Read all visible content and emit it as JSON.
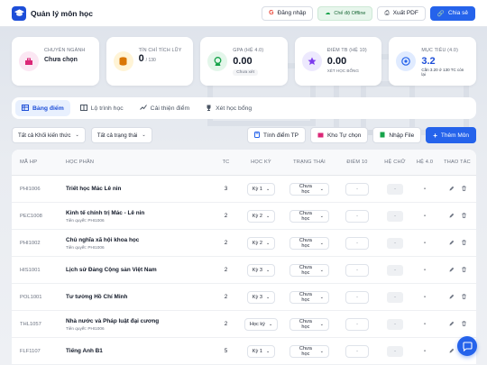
{
  "header": {
    "title": "Quản lý môn học",
    "login_label": "Đăng nhập",
    "offline_label": "Chế độ Offline",
    "export_label": "Xuất PDF",
    "share_label": "Chia sẻ"
  },
  "cards": [
    {
      "label": "Chuyên ngành",
      "value": "Chưa chọn",
      "color": "#fbe7f3"
    },
    {
      "label": "Tín chỉ tích lũy",
      "value": "0",
      "sub": "/ 130",
      "color": "#fff4d6"
    },
    {
      "label": "GPA (hệ 4.0)",
      "value": "0.00",
      "badge": "Chưa xét",
      "color": "#e3f6ea"
    },
    {
      "label": "Điểm TB (hệ 10)",
      "value": "0.00",
      "sub": "Xét học bổng",
      "color": "#ede9fe"
    },
    {
      "label": "Mục tiêu (4.0)",
      "value": "3.2",
      "sub": "Cần 3.20 ở 130 TC còn lại",
      "color": "#e0ebff"
    }
  ],
  "tabs": [
    "Bảng điểm",
    "Lộ trình học",
    "Cải thiện điểm",
    "Xét học bổng"
  ],
  "filters": {
    "knowledge": "Tất cả Khối kiến thức",
    "status": "Tất cả trạng thái",
    "calc_tp": "Tính điểm TP",
    "repo": "Kho Tự chọn",
    "import": "Nhập File",
    "add": "Thêm Môn"
  },
  "table": {
    "headers": [
      "Mã HP",
      "Học phần",
      "TC",
      "Học kỳ",
      "Trạng thái",
      "Điểm 10",
      "Hệ chữ",
      "Hệ 4.0",
      "Thao tác"
    ],
    "rows": [
      {
        "code": "PHI1006",
        "name": "Triết học Mác Lê nin",
        "prereq": "",
        "tc": "3",
        "term": "Kỳ 1",
        "status": "Chưa học",
        "d10": "-",
        "letter": "-",
        "d4": "-"
      },
      {
        "code": "PEC1008",
        "name": "Kinh tế chính trị Mác - Lê nin",
        "prereq": "Tiên quyết: PHI1006",
        "tc": "2",
        "term": "Kỳ 2",
        "status": "Chưa học",
        "d10": "-",
        "letter": "-",
        "d4": "-"
      },
      {
        "code": "PHI1002",
        "name": "Chủ nghĩa xã hội khoa học",
        "prereq": "Tiên quyết: PHI1006",
        "tc": "2",
        "term": "Kỳ 2",
        "status": "Chưa học",
        "d10": "-",
        "letter": "-",
        "d4": "-"
      },
      {
        "code": "HIS1001",
        "name": "Lịch sử Đảng Cộng sản Việt Nam",
        "prereq": "",
        "tc": "2",
        "term": "Kỳ 3",
        "status": "Chưa học",
        "d10": "-",
        "letter": "-",
        "d4": "-"
      },
      {
        "code": "POL1001",
        "name": "Tư tưởng Hồ Chí Minh",
        "prereq": "",
        "tc": "2",
        "term": "Kỳ 3",
        "status": "Chưa học",
        "d10": "-",
        "letter": "-",
        "d4": "-"
      },
      {
        "code": "THL1057",
        "name": "Nhà nước và Pháp luật đại cương",
        "prereq": "Tiên quyết: PHI1006",
        "tc": "2",
        "term": "Học kỳ",
        "status": "Chưa học",
        "d10": "-",
        "letter": "-",
        "d4": "-"
      },
      {
        "code": "FLF1107",
        "name": "Tiếng Anh B1",
        "prereq": "",
        "tc": "5",
        "term": "Kỳ 1",
        "status": "Chưa học",
        "d10": "-",
        "letter": "-",
        "d4": "-"
      }
    ]
  },
  "colors": {
    "primary": "#2563eb",
    "accent_active": "#1d4ed8"
  }
}
